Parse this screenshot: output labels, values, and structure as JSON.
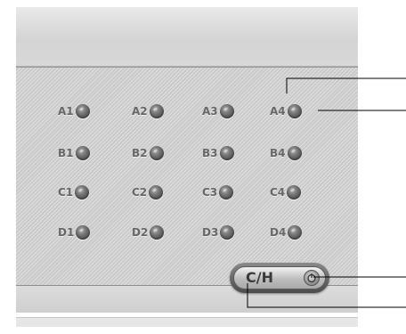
{
  "keypad": {
    "rows": [
      {
        "keys": [
          {
            "label": "A1"
          },
          {
            "label": "A2"
          },
          {
            "label": "A3"
          },
          {
            "label": "A4"
          }
        ]
      },
      {
        "keys": [
          {
            "label": "B1"
          },
          {
            "label": "B2"
          },
          {
            "label": "B3"
          },
          {
            "label": "B4"
          }
        ]
      },
      {
        "keys": [
          {
            "label": "C1"
          },
          {
            "label": "C2"
          },
          {
            "label": "C3"
          },
          {
            "label": "C4"
          }
        ]
      },
      {
        "keys": [
          {
            "label": "D1"
          },
          {
            "label": "D2"
          },
          {
            "label": "D3"
          },
          {
            "label": "D4"
          }
        ]
      }
    ]
  },
  "power_control": {
    "label": "C/H",
    "button_icon": "power-icon"
  },
  "colors": {
    "panel": "#d1d1d1",
    "key_label": "#676767",
    "key_button": "#5a5a5a",
    "callout_line": "#000000"
  }
}
